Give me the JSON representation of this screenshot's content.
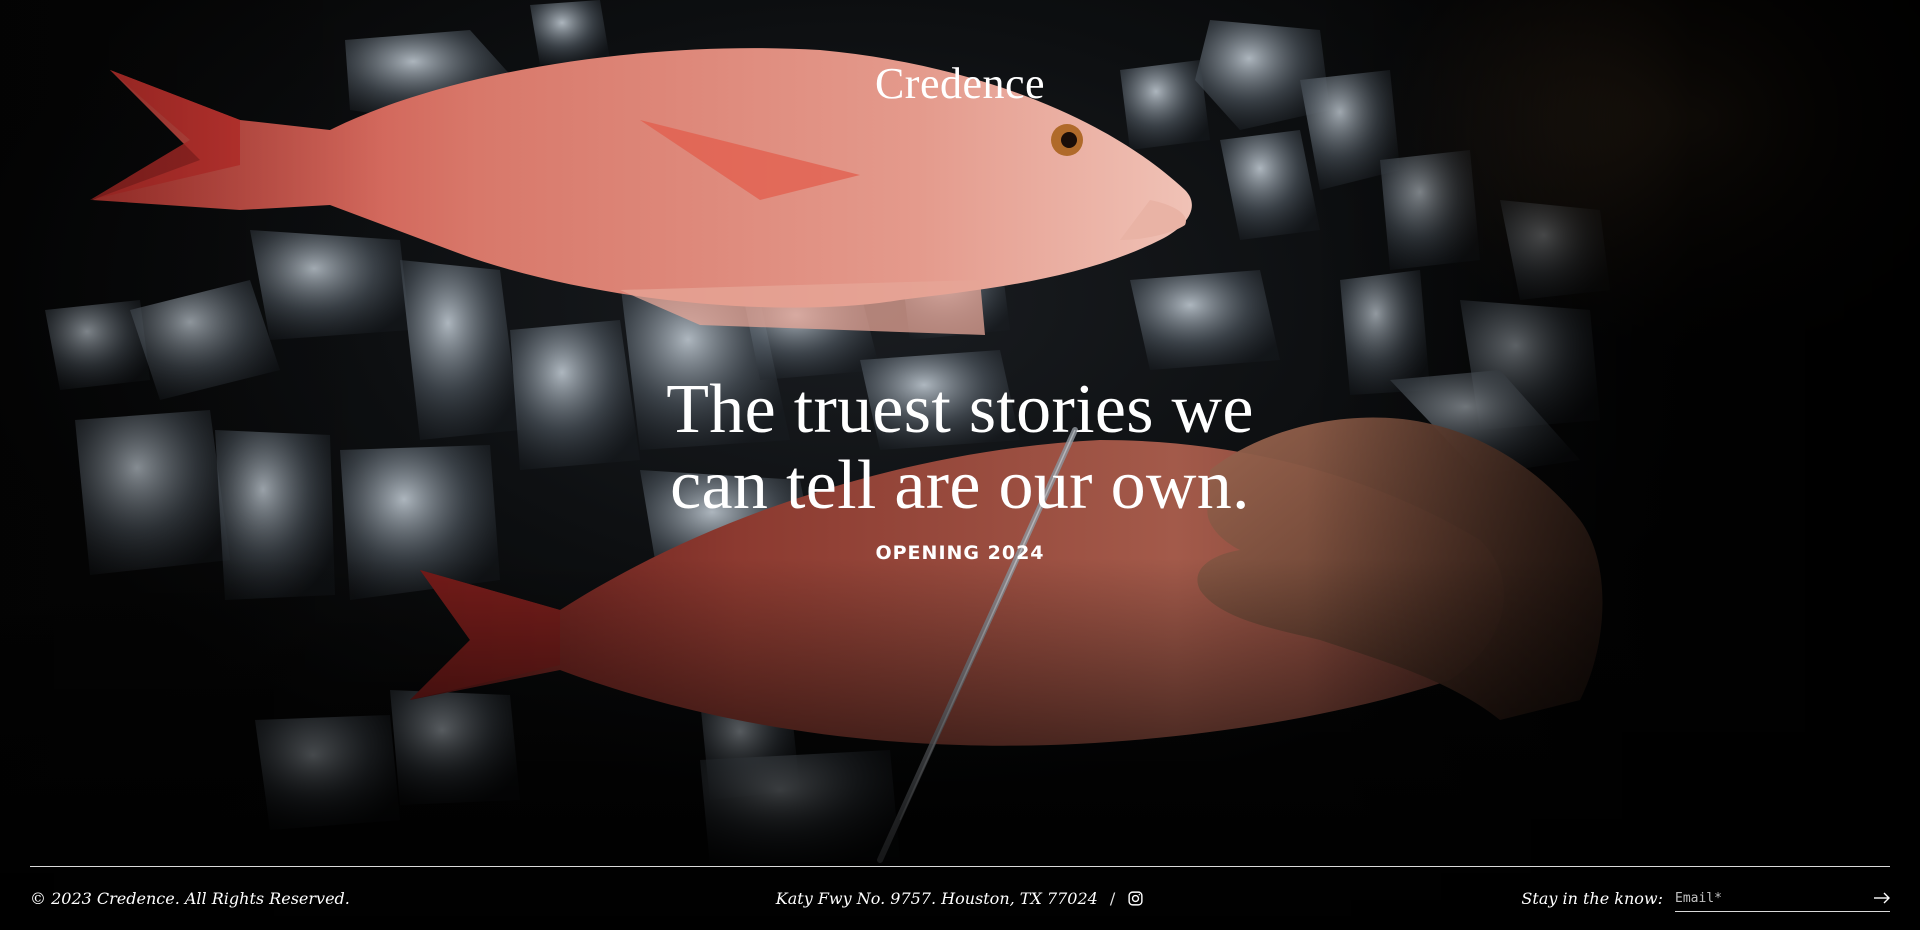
{
  "brand": {
    "logo": "Credence"
  },
  "hero": {
    "headline_line1": "The truest stories we",
    "headline_line2": "can tell are our own.",
    "subheading": "OPENING 2024"
  },
  "footer": {
    "copyright": "© 2023 Credence. All Rights Reserved.",
    "address": "Katy Fwy No. 9757. Houston, TX 77024",
    "separator": "/",
    "social_icon": "instagram-icon",
    "newsletter_label": "Stay in the know:",
    "email_placeholder": "Email*",
    "submit_icon": "arrow-right-icon"
  },
  "colors": {
    "text": "#ffffff",
    "background": "#050505",
    "fish": "#d96a5a"
  }
}
